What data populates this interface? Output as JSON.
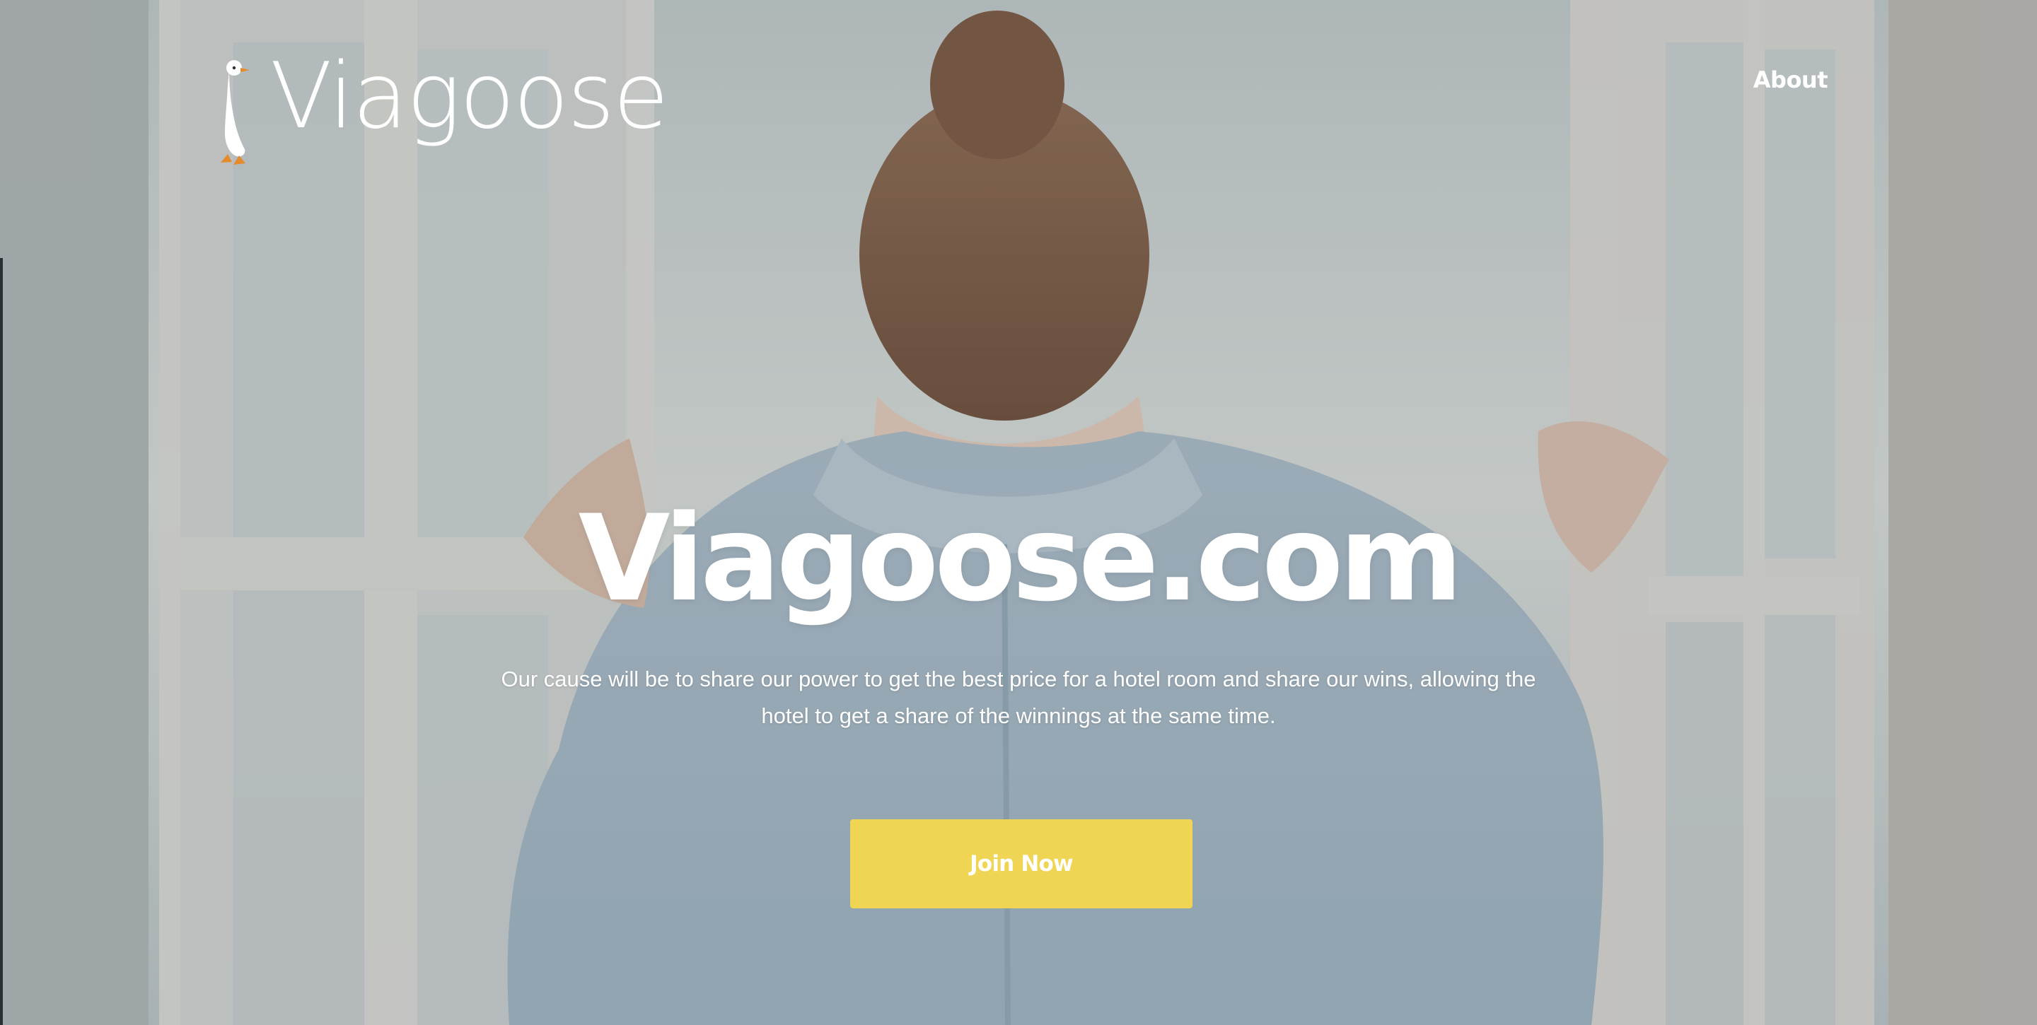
{
  "header": {
    "logo_text": "Viagoose",
    "nav": {
      "about_label": "About"
    }
  },
  "hero": {
    "title": "Viagoose.com",
    "description": "Our cause will be to share our power to get the best price for a hotel room and share our wins, allowing the hotel to get a share of the winnings at the same time.",
    "cta_label": "Join Now"
  },
  "colors": {
    "button_background": "#f0d555",
    "text": "#ffffff",
    "logo_accent": "#e58b2d"
  },
  "icons": {
    "logo_mark": "goose-icon"
  }
}
